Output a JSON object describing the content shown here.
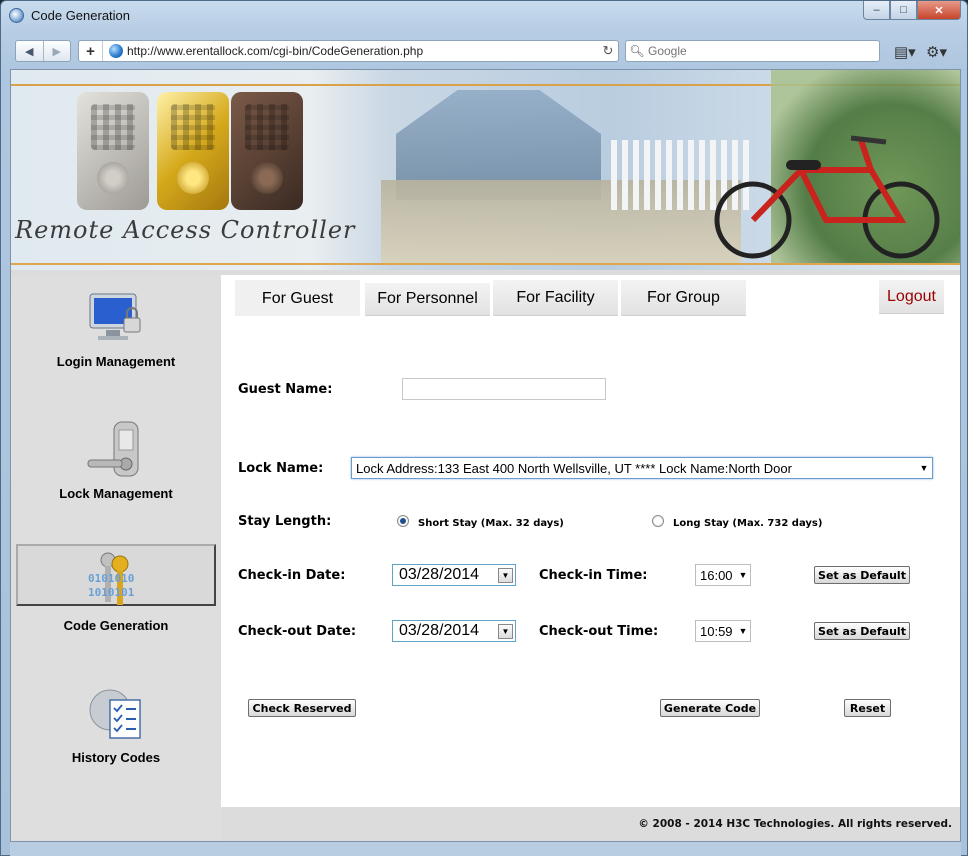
{
  "window": {
    "title": "Code Generation",
    "controls": [
      "–",
      "□",
      "✕"
    ]
  },
  "browser": {
    "url": "http://www.erentallock.com/cgi-bin/CodeGeneration.php",
    "search_placeholder": "Google",
    "back_icon": "◀",
    "forward_icon": "▶",
    "new_tab_icon": "+",
    "reload_icon": "↻",
    "search_icon": "🔍︎",
    "page_icon": "▤▾",
    "tools_icon": "⚙▾"
  },
  "banner": {
    "script_text": "Remote Access Controller"
  },
  "sidebar": {
    "items": [
      {
        "label": "Login Management"
      },
      {
        "label": "Lock Management"
      },
      {
        "label": "Code Generation",
        "icon_text": "0101010\n1010101"
      },
      {
        "label": "History Codes"
      }
    ]
  },
  "tabs": [
    {
      "label": "For Guest"
    },
    {
      "label": "For Personnel"
    },
    {
      "label": "For Facility"
    },
    {
      "label": "For Group"
    }
  ],
  "logout_label": "Logout",
  "form": {
    "guest_name_label": "Guest Name:",
    "guest_name_value": "",
    "lock_name_label": "Lock Name:",
    "lock_name_value": "Lock Address:133 East 400 North Wellsville, UT **** Lock Name:North Door",
    "stay_length_label": "Stay Length:",
    "short_stay_label": "Short Stay (Max. 32 days)",
    "long_stay_label": "Long Stay (Max. 732 days)",
    "stay_selected": "short",
    "checkin_date_label": "Check-in Date:",
    "checkin_date_value": "03/28/2014",
    "checkin_time_label": "Check-in Time:",
    "checkin_time_value": "16:00",
    "checkout_date_label": "Check-out Date:",
    "checkout_date_value": "03/28/2014",
    "checkout_time_label": "Check-out Time:",
    "checkout_time_value": "10:59",
    "set_default_label": "Set as Default",
    "check_reserved_label": "Check Reserved",
    "generate_code_label": "Generate Code",
    "reset_label": "Reset",
    "dropdown_arrow": "▼"
  },
  "footer": {
    "text": "© 2008 - 2014 H3C Technologies. All rights reserved."
  }
}
